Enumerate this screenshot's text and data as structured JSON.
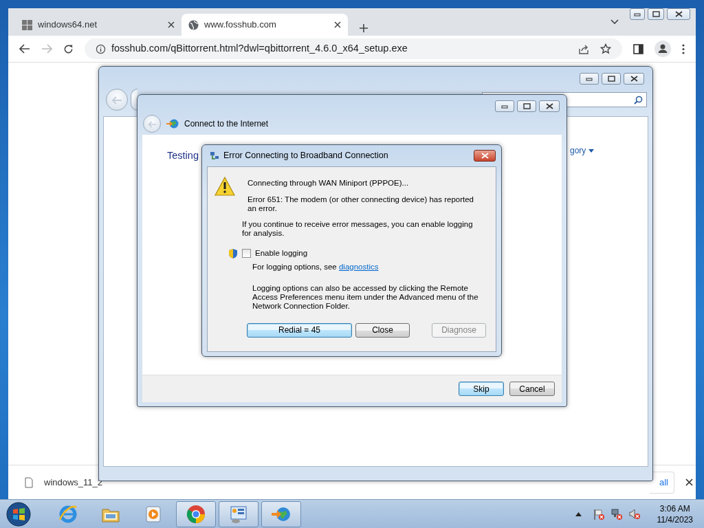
{
  "browser": {
    "tabs": [
      {
        "label": "windows64.net",
        "kind": "grid",
        "selected": false
      },
      {
        "label": "www.fosshub.com",
        "kind": "globe",
        "selected": true
      }
    ],
    "url": "fosshub.com/qBittorrent.html?dwl=qbittorrent_4.6.0_x64_setup.exe",
    "download_bar": {
      "filename": "windows_11_2",
      "show_all": "all"
    }
  },
  "control_panel": {
    "view_by": "gory"
  },
  "wizard": {
    "title": "Connect to the Internet",
    "heading": "Testing",
    "buttons": [
      {
        "label": "Skip",
        "default": true
      },
      {
        "label": "Cancel",
        "default": false
      }
    ]
  },
  "error_dialog": {
    "title": "Error Connecting to Broadband Connection",
    "status": "Connecting through WAN Miniport (PPPOE)...",
    "error": "Error 651: The modem (or other connecting device) has reported an error.",
    "advice": "If you continue to receive error messages, you can enable logging for analysis.",
    "logging": {
      "label": "Enable logging",
      "checked": false
    },
    "hint": "For logging options, see",
    "hint_link": "diagnostics",
    "note": "Logging options can also be accessed by clicking the Remote Access Preferences menu item under the Advanced menu of the Network Connection Folder.",
    "buttons": [
      {
        "label": "Redial = 45",
        "default": true,
        "disabled": false
      },
      {
        "label": "Close",
        "default": false,
        "disabled": false
      },
      {
        "label": "Diagnose",
        "default": false,
        "disabled": true
      }
    ]
  },
  "taskbar": {
    "apps": [
      {
        "kind": "ie",
        "running": false
      },
      {
        "kind": "explorer",
        "running": false
      },
      {
        "kind": "media",
        "running": false
      },
      {
        "kind": "chrome",
        "running": true
      },
      {
        "kind": "control-panel",
        "running": true
      },
      {
        "kind": "network",
        "running": true
      }
    ],
    "clock": {
      "time": "3:06 AM",
      "date": "11/4/2023"
    }
  }
}
